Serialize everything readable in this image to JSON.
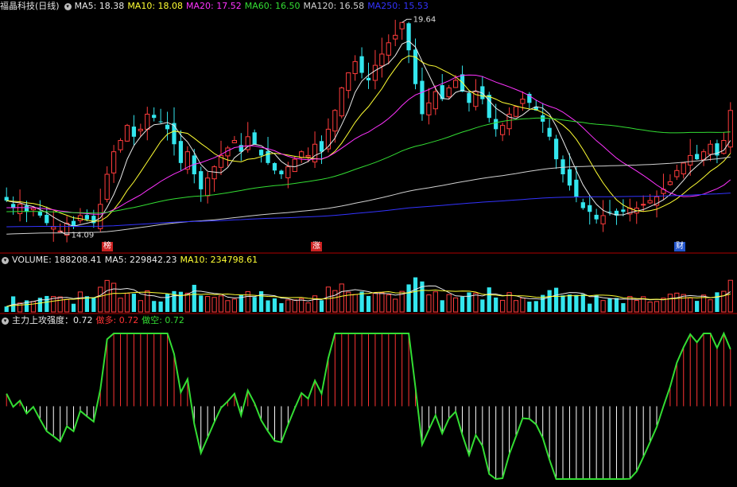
{
  "colors": {
    "background": "#000000",
    "up": "#ff3c3c",
    "down": "#33e6ee",
    "ma5": "#e8e8e8",
    "ma10": "#ffff33",
    "ma20": "#ff33ff",
    "ma60": "#33dd33",
    "ma120": "#d0d0d0",
    "ma250": "#3333ff",
    "separator": "#b00000",
    "strength_line": "#33dd33",
    "strength_up": "#ff3333",
    "strength_down": "#ffffff"
  },
  "price_panel": {
    "stock_name": "福晶科技(日线)",
    "collapse_icon": "chevron-down-icon",
    "ma_legend": [
      {
        "label": "MA5: 18.38",
        "color": "#e8e8e8"
      },
      {
        "label": "MA10: 18.08",
        "color": "#ffff33"
      },
      {
        "label": "MA20: 17.52",
        "color": "#ff33ff"
      },
      {
        "label": "MA60: 16.50",
        "color": "#33dd33"
      },
      {
        "label": "MA120: 16.58",
        "color": "#d0d0d0"
      },
      {
        "label": "MA250: 15.53",
        "color": "#3333ff"
      }
    ],
    "high_label": "19.64",
    "low_label": "14.09",
    "event_tags": [
      {
        "text": "榜",
        "color": "#cc2222"
      },
      {
        "text": "涨",
        "color": "#cc2222"
      },
      {
        "text": "财",
        "color": "#2255cc"
      }
    ]
  },
  "volume_panel": {
    "legend": [
      {
        "label": "VOLUME: 188208.41",
        "color": "#e8e8e8"
      },
      {
        "label": "MA5: 229842.23",
        "color": "#e8e8e8"
      },
      {
        "label": "MA10: 234798.61",
        "color": "#ffff33"
      }
    ]
  },
  "strength_panel": {
    "legend": [
      {
        "label": "主力上攻强度：0.72",
        "color": "#e8e8e8"
      },
      {
        "label": "做多: 0.72",
        "color": "#ff3333"
      },
      {
        "label": "做空: 0.72",
        "color": "#33dd33"
      }
    ]
  },
  "chart_data": {
    "type": "candlestick",
    "close": [
      14.9,
      14.7,
      14.8,
      14.6,
      14.7,
      14.5,
      14.3,
      14.2,
      14.09,
      14.3,
      14.2,
      14.5,
      14.4,
      14.3,
      14.8,
      15.6,
      16.2,
      16.5,
      16.9,
      16.6,
      16.8,
      17.2,
      17.1,
      17.0,
      16.8,
      16.4,
      15.9,
      16.2,
      15.6,
      15.2,
      15.5,
      15.8,
      16.1,
      16.3,
      16.5,
      16.2,
      16.6,
      16.4,
      16.1,
      15.9,
      15.7,
      15.6,
      15.8,
      16.0,
      16.2,
      16.1,
      16.4,
      16.2,
      16.8,
      17.3,
      17.9,
      18.3,
      18.6,
      18.3,
      18.1,
      18.5,
      18.8,
      19.1,
      19.3,
      19.64,
      18.9,
      18.0,
      17.2,
      17.5,
      17.8,
      17.6,
      17.9,
      18.1,
      17.8,
      17.5,
      17.8,
      17.6,
      17.1,
      16.8,
      16.9,
      17.2,
      17.4,
      17.6,
      17.5,
      17.3,
      17.0,
      16.6,
      16.0,
      15.6,
      15.3,
      15.0,
      14.7,
      14.6,
      14.4,
      14.5,
      14.6,
      14.5,
      14.6,
      14.7,
      14.7,
      14.8,
      14.9,
      15.0,
      15.2,
      15.4,
      15.7,
      15.9,
      16.1,
      16.0,
      16.2,
      16.4,
      16.1,
      16.5,
      17.3
    ],
    "ylim": [
      13.8,
      19.9
    ],
    "high": 19.64,
    "low": 14.09,
    "volume_ylim": [
      0,
      1500000
    ],
    "strength_ylim": [
      -1.0,
      1.0
    ],
    "strength_last": 0.72
  }
}
